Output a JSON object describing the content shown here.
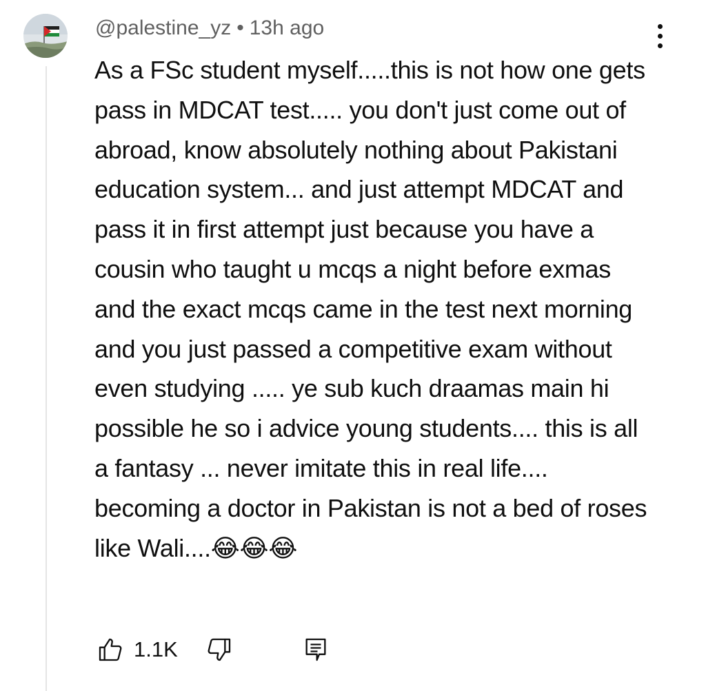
{
  "comment": {
    "author": "@palestine_yz",
    "separator": "•",
    "time": "13h ago",
    "text": "As a FSc student myself.....this is not how one gets pass in MDCAT test..... you don't just come out of abroad, know absolutely nothing about Pakistani education system... and just attempt MDCAT and pass it in first attempt just because you have a cousin who taught u mcqs a night before exmas and the exact mcqs came in the test next morning and you just passed a competitive exam without even studying ..... ye sub kuch draamas main hi possible he so i advice young students.... this is all a fantasy ... never imitate this in real life.... becoming a doctor in Pakistan is not a bed of roses like Wali....😂😂😂",
    "like_count": "1.1K"
  },
  "icons": {
    "avatar": "palestine-flag-avatar",
    "menu": "more-vert-icon",
    "like": "thumb-up-icon",
    "dislike": "thumb-down-icon",
    "reply": "comment-reply-icon"
  },
  "colors": {
    "text": "#0f0f0f",
    "secondary": "#606060",
    "thread_line": "#e5e5e5"
  }
}
